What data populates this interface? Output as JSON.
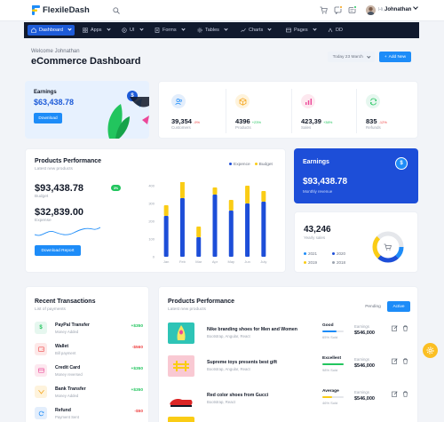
{
  "app": {
    "name": "FlexileDash"
  },
  "user": {
    "greeting": "Hi,",
    "name": "Johnathan"
  },
  "nav": {
    "items": [
      {
        "label": "Dashboard",
        "icon": "home-icon"
      },
      {
        "label": "Apps",
        "icon": "grid-icon"
      },
      {
        "label": "UI",
        "icon": "layers-icon"
      },
      {
        "label": "Forms",
        "icon": "file-icon"
      },
      {
        "label": "Tables",
        "icon": "table-icon"
      },
      {
        "label": "Charts",
        "icon": "chart-icon"
      },
      {
        "label": "Pages",
        "icon": "pages-icon"
      },
      {
        "label": "DD",
        "icon": "share-icon"
      }
    ]
  },
  "header": {
    "welcome": "Welcome Johnathan",
    "title": "eCommerce Dashboard",
    "date_label": "Today 23 March",
    "add_label": "Add New"
  },
  "earnings_card": {
    "title": "Earnings",
    "value": "$63,438.78",
    "button": "Download",
    "badge": "$"
  },
  "stats": [
    {
      "value": "39,354",
      "pct": "-9%",
      "label": "Customers",
      "color": "#ef4444",
      "icon": "users-icon"
    },
    {
      "value": "4396",
      "pct": "+23%",
      "label": "Products",
      "color": "#22c55e",
      "icon": "box-icon"
    },
    {
      "value": "423,39",
      "pct": "+38%",
      "label": "Sales",
      "color": "#22c55e",
      "icon": "sales-chart-icon"
    },
    {
      "value": "835",
      "pct": "-12%",
      "label": "Refunds",
      "color": "#ef4444",
      "icon": "refresh-icon"
    }
  ],
  "performance": {
    "title": "Products Performance",
    "subtitle": "Latest new products",
    "legend": [
      "Expence",
      "Budget"
    ],
    "budget_value": "$93,438.78",
    "budget_pct": "3%",
    "budget_label": "Budget",
    "expense_value": "$32,839.00",
    "expense_label": "Expense",
    "button": "Download Report"
  },
  "chart_data": {
    "type": "bar",
    "categories": [
      "Jan",
      "Feb",
      "Mar",
      "Apr",
      "May",
      "Jun",
      "July"
    ],
    "yticks": [
      0,
      100,
      200,
      300,
      400
    ],
    "ylim": [
      0,
      400
    ],
    "series": [
      {
        "name": "Expence",
        "color": "#1d4ed8",
        "values": [
          230,
          330,
          110,
          350,
          260,
          300,
          310
        ]
      },
      {
        "name": "Budget",
        "color": "#facc15",
        "values": [
          60,
          100,
          60,
          40,
          60,
          100,
          60
        ]
      }
    ]
  },
  "earnings_monthly": {
    "title": "Earnings",
    "value": "$93,438.78",
    "subtitle": "Monthly revenue",
    "badge": "$"
  },
  "yearly_sales": {
    "value": "43,246",
    "label": "Yearly sales",
    "years": [
      {
        "label": "2021",
        "color": "#1d8cf8"
      },
      {
        "label": "2020",
        "color": "#1d4ed8"
      },
      {
        "label": "2019",
        "color": "#facc15"
      },
      {
        "label": "2018",
        "color": "#9ca3af"
      }
    ]
  },
  "transactions": {
    "title": "Recent Transactions",
    "subtitle": "List of payments",
    "items": [
      {
        "name": "PayPal Transfer",
        "sub": "Money Added",
        "amount": "+$350",
        "color": "#22c55e",
        "bg": "#e6f7ef",
        "icon": "paypal-icon"
      },
      {
        "name": "Wallet",
        "sub": "Bill payment",
        "amount": "-$560",
        "color": "#ef4444",
        "bg": "#fde8e8",
        "icon": "wallet-icon"
      },
      {
        "name": "Credit Card",
        "sub": "Money reversed",
        "amount": "+$350",
        "color": "#22c55e",
        "bg": "#fde8ef",
        "icon": "card-icon"
      },
      {
        "name": "Bank Transfer",
        "sub": "Money Added",
        "amount": "+$350",
        "color": "#22c55e",
        "bg": "#fef3dc",
        "icon": "bank-icon"
      },
      {
        "name": "Refund",
        "sub": "Payment Sent",
        "amount": "-$50",
        "color": "#ef4444",
        "bg": "#e3eefc",
        "icon": "refund-icon"
      }
    ]
  },
  "products_table": {
    "title": "Products Performance",
    "subtitle": "Latest new products",
    "tabs": [
      "Pending",
      "Active"
    ],
    "earnings_label": "Earnings",
    "rows": [
      {
        "name": "Nike branding shoes for Men and Women",
        "tags": "Bootstrap, Angular, React",
        "status": "Good",
        "sold": "65% Sold",
        "progress": 0.65,
        "progress_color": "#1d8cf8",
        "earnings": "$546,000",
        "img_bg": "#2ec4b6"
      },
      {
        "name": "Supreme toys presents best gift",
        "tags": "Bootstrap, Angular, React",
        "status": "Excellent",
        "sold": "98% Sold",
        "progress": 0.98,
        "progress_color": "#22c55e",
        "earnings": "$546,000",
        "img_bg": "#f9c9d3"
      },
      {
        "name": "Red color shoes from Gucci",
        "tags": "Bootstrap, React",
        "status": "Average",
        "sold": "46% Sold",
        "progress": 0.46,
        "progress_color": "#facc15",
        "earnings": "$546,000",
        "img_bg": "#ffffff"
      }
    ]
  }
}
